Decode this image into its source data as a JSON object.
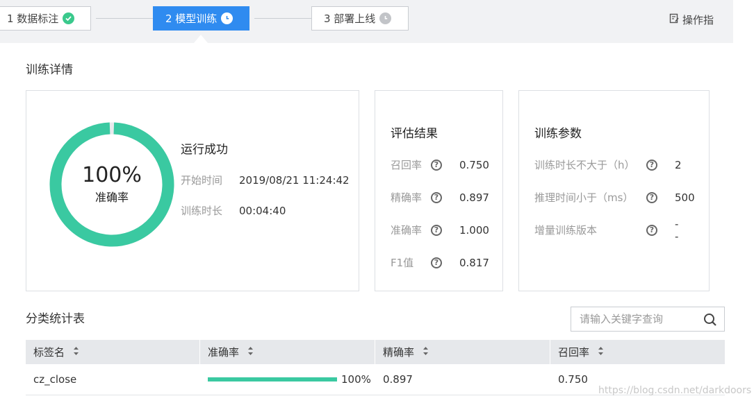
{
  "steps": [
    {
      "label": "1 数据标注",
      "state": "done"
    },
    {
      "label": "2 模型训练",
      "state": "active"
    },
    {
      "label": "3 部署上线",
      "state": "pending"
    }
  ],
  "top_right": {
    "label": "操作指",
    "icon": "document-edit-icon"
  },
  "detail": {
    "title": "训练详情",
    "ring": {
      "percent": "100%",
      "label": "准确率",
      "value": 1.0,
      "color": "#3ac9a1"
    },
    "status": "运行成功",
    "start_time_label": "开始时间",
    "start_time": "2019/08/21 11:24:42",
    "duration_label": "训练时长",
    "duration": "00:04:40"
  },
  "eval": {
    "title": "评估结果",
    "rows": [
      {
        "label": "召回率",
        "value": "0.750"
      },
      {
        "label": "精确率",
        "value": "0.897"
      },
      {
        "label": "准确率",
        "value": "1.000"
      },
      {
        "label": "F1值",
        "value": "0.817"
      }
    ]
  },
  "params": {
    "title": "训练参数",
    "rows": [
      {
        "label": "训练时长不大于（h）",
        "value": "2"
      },
      {
        "label": "推理时间小于（ms）",
        "value": "500"
      },
      {
        "label": "增量训练版本",
        "value": "--"
      }
    ]
  },
  "stats": {
    "title": "分类统计表",
    "search_placeholder": "请输入关键字查询",
    "columns": [
      "标签名",
      "准确率",
      "精确率",
      "召回率"
    ],
    "rows": [
      {
        "name": "cz_close",
        "accuracy": "100%",
        "accuracy_value": 1.0,
        "precision": "0.897",
        "recall": "0.750"
      }
    ]
  },
  "watermark": "https://blog.csdn.net/darkdoors",
  "colors": {
    "accent": "#2f8bf0",
    "success": "#3ac98c",
    "ring": "#3ac9a1"
  }
}
